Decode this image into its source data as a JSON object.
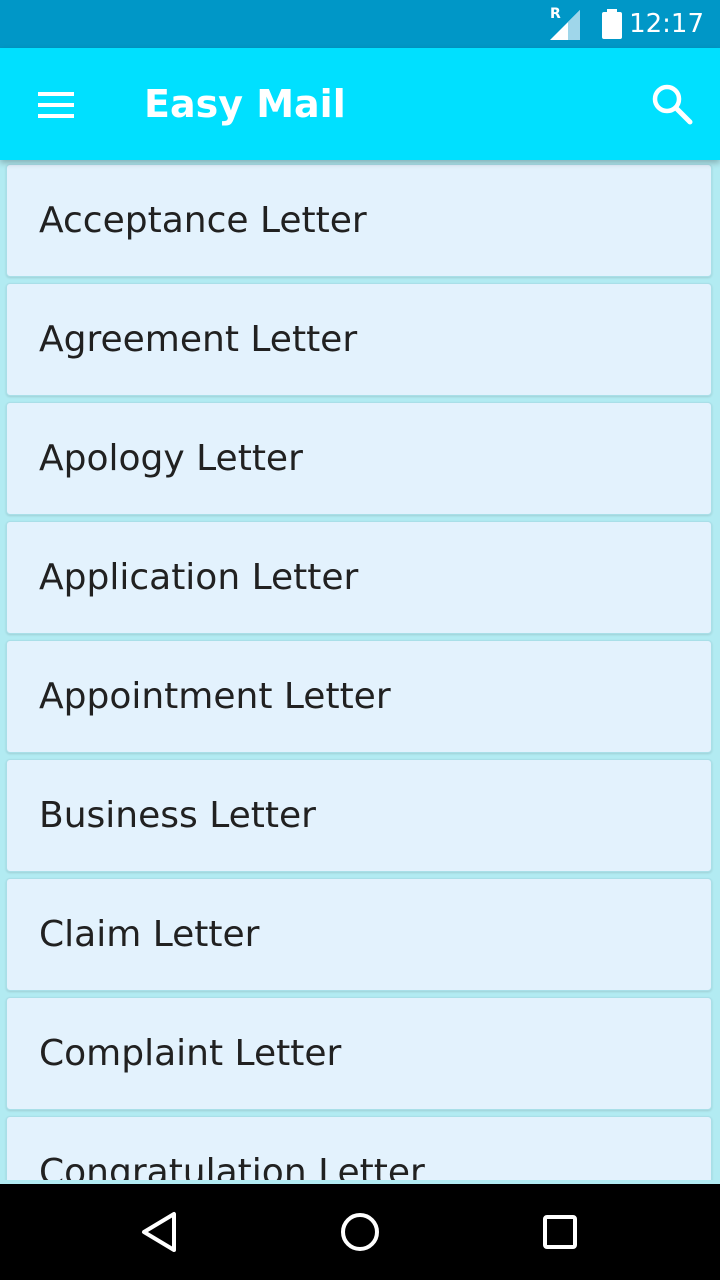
{
  "status_bar": {
    "time": "12:17",
    "network_badge": "R",
    "signal_icon": "signal-icon",
    "battery_icon": "battery-icon"
  },
  "app_bar": {
    "title": "Easy Mail",
    "menu_icon": "menu-icon",
    "search_icon": "search-icon",
    "background_color": "#00e0ff"
  },
  "letters": [
    {
      "label": "Acceptance Letter"
    },
    {
      "label": "Agreement Letter"
    },
    {
      "label": "Apology Letter"
    },
    {
      "label": "Application Letter"
    },
    {
      "label": "Appointment Letter"
    },
    {
      "label": "Business Letter"
    },
    {
      "label": "Claim Letter"
    },
    {
      "label": "Complaint Letter"
    },
    {
      "label": "Congratulation Letter"
    }
  ],
  "nav_bar": {
    "back_icon": "back-icon",
    "home_icon": "home-icon",
    "recents_icon": "recents-icon"
  }
}
